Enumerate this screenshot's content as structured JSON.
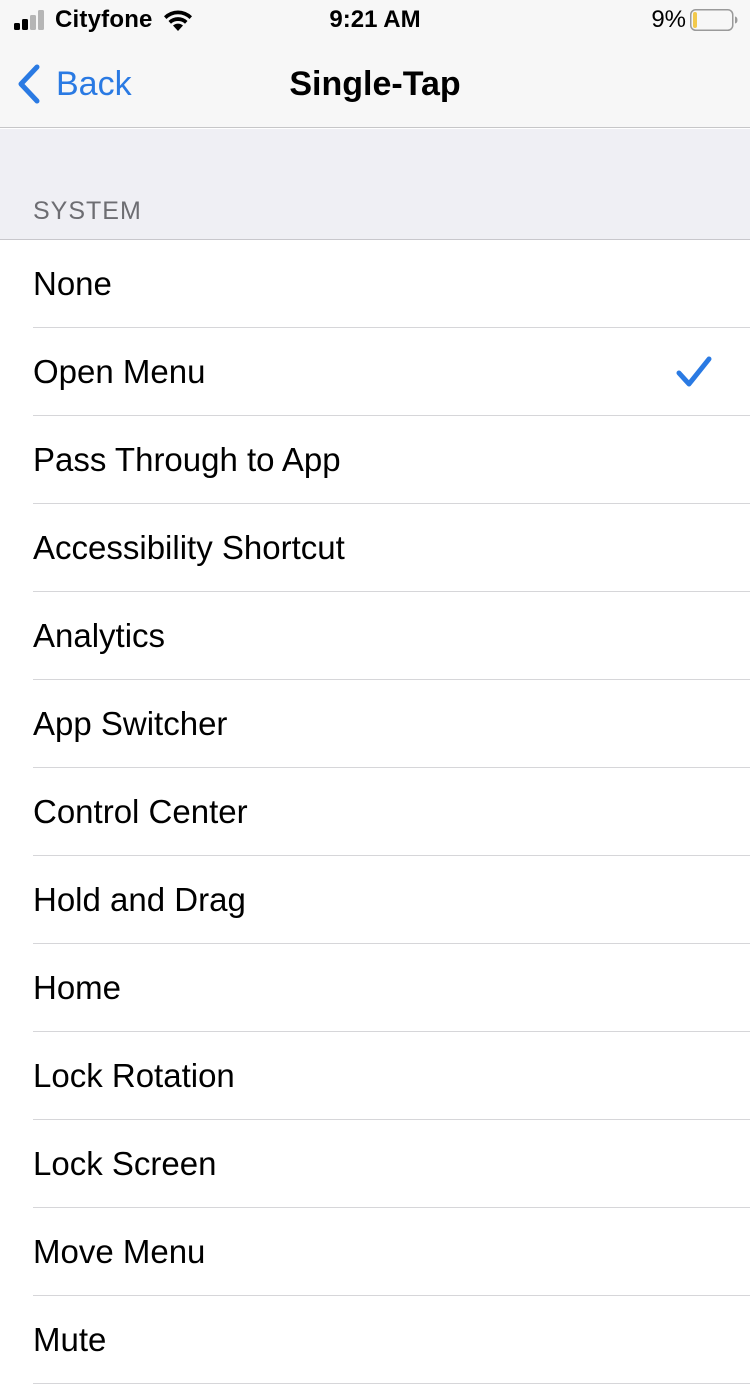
{
  "status_bar": {
    "carrier": "Cityfone",
    "time": "9:21 AM",
    "battery_percent": "9%",
    "signal_bars_active": 2,
    "signal_bars_total": 4,
    "battery_level": 0.09,
    "battery_fill_color": "#f2c94c",
    "icons": [
      "signal-icon",
      "wifi-icon",
      "battery-icon"
    ]
  },
  "nav": {
    "back_label": "Back",
    "title": "Single-Tap",
    "accent_color": "#2a7ae3"
  },
  "section": {
    "header": "SYSTEM"
  },
  "items": [
    {
      "label": "None",
      "selected": false
    },
    {
      "label": "Open Menu",
      "selected": true
    },
    {
      "label": "Pass Through to App",
      "selected": false
    },
    {
      "label": "Accessibility Shortcut",
      "selected": false
    },
    {
      "label": "Analytics",
      "selected": false
    },
    {
      "label": "App Switcher",
      "selected": false
    },
    {
      "label": "Control Center",
      "selected": false
    },
    {
      "label": "Hold and Drag",
      "selected": false
    },
    {
      "label": "Home",
      "selected": false
    },
    {
      "label": "Lock Rotation",
      "selected": false
    },
    {
      "label": "Lock Screen",
      "selected": false
    },
    {
      "label": "Move Menu",
      "selected": false
    },
    {
      "label": "Mute",
      "selected": false
    }
  ]
}
